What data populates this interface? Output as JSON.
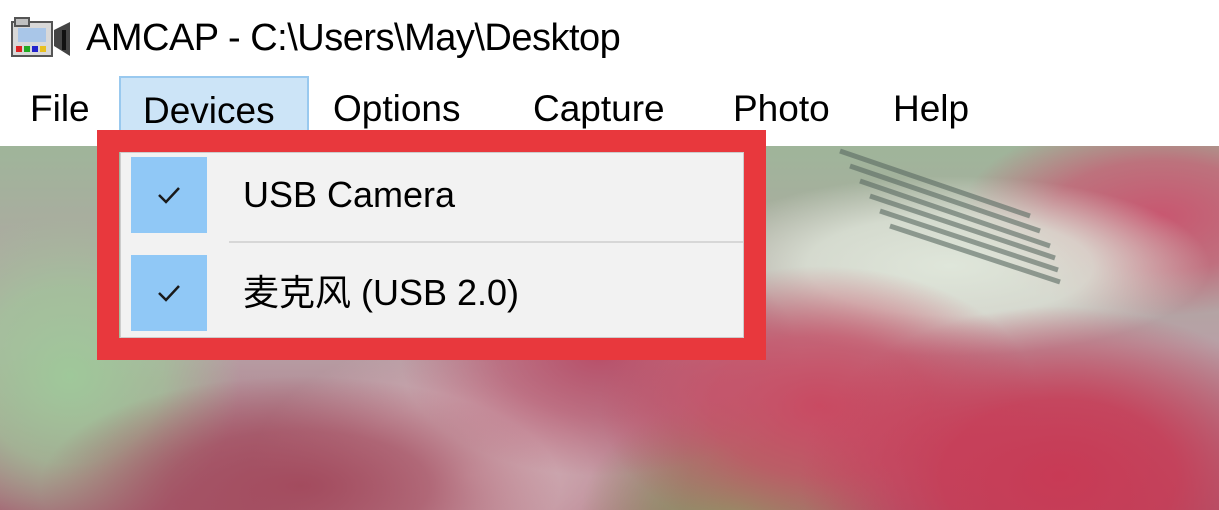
{
  "window": {
    "title": "AMCAP - C:\\Users\\May\\Desktop",
    "icon": "camera-app-icon"
  },
  "menubar": {
    "items": [
      {
        "label": "File"
      },
      {
        "label": "Devices",
        "active": true
      },
      {
        "label": "Options"
      },
      {
        "label": "Capture"
      },
      {
        "label": "Photo"
      },
      {
        "label": "Help"
      }
    ]
  },
  "devices_menu": {
    "items": [
      {
        "label": "USB Camera",
        "checked": true,
        "icon": "checkmark-icon"
      },
      {
        "label": "麦克风 (USB 2.0)",
        "checked": true,
        "icon": "checkmark-icon"
      }
    ]
  },
  "colors": {
    "menu_active_bg": "#cce4f7",
    "menu_active_border": "#99c9ef",
    "check_bg": "#90c8f6",
    "dropdown_bg": "#f2f2f2",
    "highlight_border": "#e8383d"
  }
}
